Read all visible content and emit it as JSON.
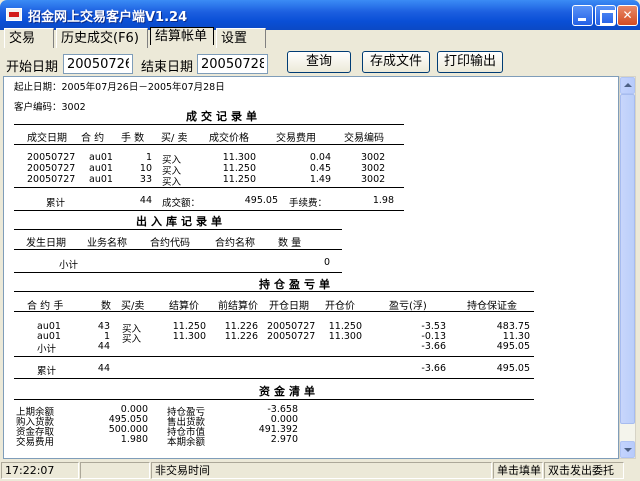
{
  "window": {
    "title": "招金网上交易客户端V1.24"
  },
  "tabs": [
    "交易",
    "历史成交(F6)",
    "结算帐单",
    "设置"
  ],
  "toolbar": {
    "start_label": "开始日期",
    "start_value": "20050726",
    "end_label": "结束日期",
    "end_value": "20050728",
    "query": "查询",
    "save": "存成文件",
    "print": "打印输出"
  },
  "report": {
    "date_range": "起止日期：2005年07月26日－2005年07月28日",
    "customer": "客户编码：3002",
    "trades": {
      "title": "成交记录单",
      "headers": [
        "成交日期",
        "合 约",
        "手 数",
        "买/ 卖",
        "成交价格",
        "交易费用",
        "交易编码"
      ],
      "rows": [
        [
          "20050727",
          "au01",
          "1",
          "买入",
          "11.300",
          "0.04",
          "3002"
        ],
        [
          "20050727",
          "au01",
          "10",
          "买入",
          "11.250",
          "0.45",
          "3002"
        ],
        [
          "20050727",
          "au01",
          "33",
          "买入",
          "11.250",
          "1.49",
          "3002"
        ]
      ],
      "total": {
        "label": "累计",
        "qty": "44",
        "amount_label": "成交额：",
        "amount": "495.05",
        "fee_label": "手续费：",
        "fee": "1.98"
      }
    },
    "stock": {
      "title": "出入库记录单",
      "headers": [
        "发生日期",
        "业务名称",
        "合约代码",
        "合约名称",
        "数 量"
      ],
      "subtotal_label": "小计",
      "subtotal_value": "0"
    },
    "positions": {
      "title": "持仓盈亏单",
      "headers": [
        "合 约 手",
        "数",
        "买/卖",
        "结算价",
        "前结算价",
        "开仓日期",
        "开仓价",
        "盈亏(浮)",
        "持仓保证金"
      ],
      "rows": [
        [
          "au01",
          "43",
          "买入",
          "11.250",
          "11.226",
          "20050727",
          "11.250",
          "-3.53",
          "483.75"
        ],
        [
          "au01",
          "1",
          "买入",
          "11.300",
          "11.226",
          "20050727",
          "11.300",
          "-0.13",
          "11.30"
        ]
      ],
      "subtotal": {
        "label": "小计",
        "qty": "44",
        "pnl": "-3.66",
        "margin": "495.05"
      },
      "total": {
        "label": "累计",
        "qty": "44",
        "pnl": "-3.66",
        "margin": "495.05"
      }
    },
    "funds": {
      "title": "资金清单",
      "left": [
        {
          "label": "上期余额",
          "value": "0.000"
        },
        {
          "label": "购入货款",
          "value": "495.050"
        },
        {
          "label": "资金存取",
          "value": "500.000"
        },
        {
          "label": "交易费用",
          "value": "1.980"
        }
      ],
      "right": [
        {
          "label": "持仓盈亏",
          "value": "-3.658"
        },
        {
          "label": "售出货款",
          "value": "0.000"
        },
        {
          "label": "持仓市值",
          "value": "491.392"
        },
        {
          "label": "本期余额",
          "value": "2.970"
        }
      ]
    }
  },
  "status": {
    "time": "17:22:07",
    "blank": "",
    "state": "非交易时间",
    "single_click": "单击填单",
    "double_click": "双击发出委托"
  }
}
